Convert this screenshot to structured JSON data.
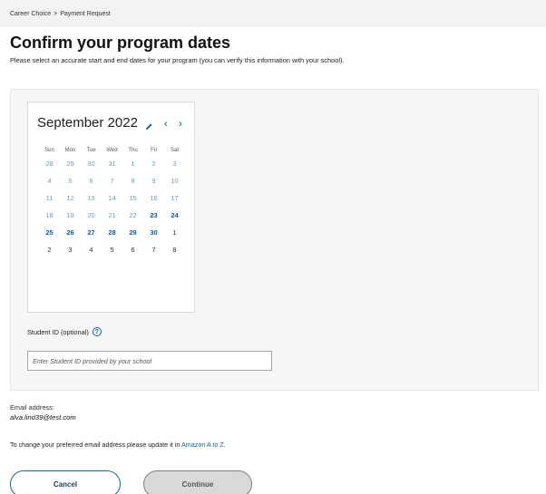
{
  "breadcrumb": {
    "parent": "Career Choice",
    "separator": ">",
    "current": "Payment Request"
  },
  "page": {
    "title": "Confirm your program dates",
    "subtitle": "Please select an accurate start and end dates for your program (you can verify this information with your school)."
  },
  "calendar": {
    "month_label": "September 2022",
    "prev_icon": "‹",
    "next_icon": "›",
    "weekdays": [
      "Sun",
      "Mon",
      "Tue",
      "Wed",
      "Thu",
      "Fri",
      "Sat"
    ],
    "weeks": [
      [
        {
          "d": "28",
          "s": "past"
        },
        {
          "d": "29",
          "s": "past"
        },
        {
          "d": "30",
          "s": "past"
        },
        {
          "d": "31",
          "s": "past"
        },
        {
          "d": "1",
          "s": "past"
        },
        {
          "d": "2",
          "s": "past"
        },
        {
          "d": "3",
          "s": "past"
        }
      ],
      [
        {
          "d": "4",
          "s": "past"
        },
        {
          "d": "5",
          "s": "past"
        },
        {
          "d": "6",
          "s": "past"
        },
        {
          "d": "7",
          "s": "past"
        },
        {
          "d": "8",
          "s": "past"
        },
        {
          "d": "9",
          "s": "past"
        },
        {
          "d": "10",
          "s": "past"
        }
      ],
      [
        {
          "d": "11",
          "s": "past"
        },
        {
          "d": "12",
          "s": "past"
        },
        {
          "d": "13",
          "s": "past"
        },
        {
          "d": "14",
          "s": "past"
        },
        {
          "d": "15",
          "s": "past"
        },
        {
          "d": "16",
          "s": "past"
        },
        {
          "d": "17",
          "s": "past"
        }
      ],
      [
        {
          "d": "18",
          "s": "past"
        },
        {
          "d": "19",
          "s": "past"
        },
        {
          "d": "20",
          "s": "past"
        },
        {
          "d": "21",
          "s": "past"
        },
        {
          "d": "22",
          "s": "past"
        },
        {
          "d": "23",
          "s": "avail"
        },
        {
          "d": "24",
          "s": "avail"
        }
      ],
      [
        {
          "d": "25",
          "s": "avail"
        },
        {
          "d": "26",
          "s": "avail"
        },
        {
          "d": "27",
          "s": "avail"
        },
        {
          "d": "28",
          "s": "avail"
        },
        {
          "d": "29",
          "s": "avail"
        },
        {
          "d": "30",
          "s": "avail"
        },
        {
          "d": "1",
          "s": "next"
        }
      ],
      [
        {
          "d": "2",
          "s": "next"
        },
        {
          "d": "3",
          "s": "next"
        },
        {
          "d": "4",
          "s": "next"
        },
        {
          "d": "5",
          "s": "next"
        },
        {
          "d": "6",
          "s": "next"
        },
        {
          "d": "7",
          "s": "next"
        },
        {
          "d": "8",
          "s": "next"
        }
      ]
    ]
  },
  "student_id": {
    "label": "Student ID (optional)",
    "help_icon": "?",
    "value": "",
    "placeholder": "Enter Student ID provided by your school"
  },
  "email": {
    "label": "Email address:",
    "value": "alva.lind39@test.com",
    "change_text": "To change your preferred email address please update it in",
    "change_link": "Amazon A to Z."
  },
  "buttons": {
    "cancel": "Cancel",
    "continue": "Continue"
  },
  "colors": {
    "link": "#0b6a9c",
    "available_day": "#0c5aa2",
    "past_day": "#6a9ec4"
  }
}
